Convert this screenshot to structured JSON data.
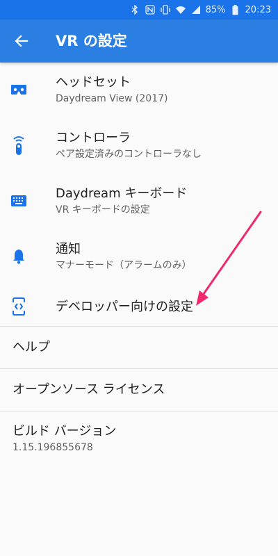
{
  "status": {
    "battery_percent": "85%",
    "time": "20:23",
    "icons": [
      "bluetooth-icon",
      "nfc-icon",
      "vibrate-icon",
      "wifi-icon",
      "signal-icon",
      "battery-icon"
    ]
  },
  "appbar": {
    "title": "VR の設定",
    "back_icon": "arrow-back-icon"
  },
  "items": [
    {
      "title": "ヘッドセット",
      "subtitle": "Daydream View (2017)",
      "icon": "vr-headset-icon"
    },
    {
      "title": "コントローラ",
      "subtitle": "ペア設定済みのコントローラなし",
      "icon": "controller-icon"
    },
    {
      "title": "Daydream キーボード",
      "subtitle": "VR キーボードの設定",
      "icon": "keyboard-icon"
    },
    {
      "title": "通知",
      "subtitle": "マナーモード（アラームのみ）",
      "icon": "bell-icon"
    },
    {
      "title": "デベロッパー向けの設定",
      "icon": "developer-icon"
    }
  ],
  "help": {
    "title": "ヘルプ"
  },
  "licenses": {
    "title": "オープンソース ライセンス"
  },
  "build": {
    "title": "ビルド バージョン",
    "value": "1.15.196855678"
  },
  "colors": {
    "accent": "#2b7fe3",
    "status": "#1a73e8",
    "arrow": "#f0296e",
    "icon": "#1a73e8"
  }
}
